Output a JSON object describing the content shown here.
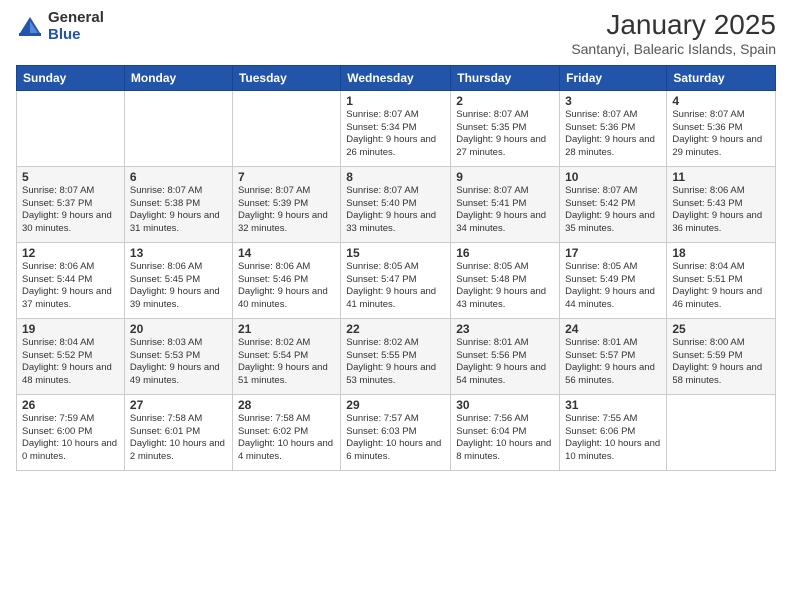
{
  "logo": {
    "general": "General",
    "blue": "Blue"
  },
  "title": "January 2025",
  "subtitle": "Santanyi, Balearic Islands, Spain",
  "headers": [
    "Sunday",
    "Monday",
    "Tuesday",
    "Wednesday",
    "Thursday",
    "Friday",
    "Saturday"
  ],
  "weeks": [
    [
      {
        "day": "",
        "info": ""
      },
      {
        "day": "",
        "info": ""
      },
      {
        "day": "",
        "info": ""
      },
      {
        "day": "1",
        "info": "Sunrise: 8:07 AM\nSunset: 5:34 PM\nDaylight: 9 hours and 26 minutes."
      },
      {
        "day": "2",
        "info": "Sunrise: 8:07 AM\nSunset: 5:35 PM\nDaylight: 9 hours and 27 minutes."
      },
      {
        "day": "3",
        "info": "Sunrise: 8:07 AM\nSunset: 5:36 PM\nDaylight: 9 hours and 28 minutes."
      },
      {
        "day": "4",
        "info": "Sunrise: 8:07 AM\nSunset: 5:36 PM\nDaylight: 9 hours and 29 minutes."
      }
    ],
    [
      {
        "day": "5",
        "info": "Sunrise: 8:07 AM\nSunset: 5:37 PM\nDaylight: 9 hours and 30 minutes."
      },
      {
        "day": "6",
        "info": "Sunrise: 8:07 AM\nSunset: 5:38 PM\nDaylight: 9 hours and 31 minutes."
      },
      {
        "day": "7",
        "info": "Sunrise: 8:07 AM\nSunset: 5:39 PM\nDaylight: 9 hours and 32 minutes."
      },
      {
        "day": "8",
        "info": "Sunrise: 8:07 AM\nSunset: 5:40 PM\nDaylight: 9 hours and 33 minutes."
      },
      {
        "day": "9",
        "info": "Sunrise: 8:07 AM\nSunset: 5:41 PM\nDaylight: 9 hours and 34 minutes."
      },
      {
        "day": "10",
        "info": "Sunrise: 8:07 AM\nSunset: 5:42 PM\nDaylight: 9 hours and 35 minutes."
      },
      {
        "day": "11",
        "info": "Sunrise: 8:06 AM\nSunset: 5:43 PM\nDaylight: 9 hours and 36 minutes."
      }
    ],
    [
      {
        "day": "12",
        "info": "Sunrise: 8:06 AM\nSunset: 5:44 PM\nDaylight: 9 hours and 37 minutes."
      },
      {
        "day": "13",
        "info": "Sunrise: 8:06 AM\nSunset: 5:45 PM\nDaylight: 9 hours and 39 minutes."
      },
      {
        "day": "14",
        "info": "Sunrise: 8:06 AM\nSunset: 5:46 PM\nDaylight: 9 hours and 40 minutes."
      },
      {
        "day": "15",
        "info": "Sunrise: 8:05 AM\nSunset: 5:47 PM\nDaylight: 9 hours and 41 minutes."
      },
      {
        "day": "16",
        "info": "Sunrise: 8:05 AM\nSunset: 5:48 PM\nDaylight: 9 hours and 43 minutes."
      },
      {
        "day": "17",
        "info": "Sunrise: 8:05 AM\nSunset: 5:49 PM\nDaylight: 9 hours and 44 minutes."
      },
      {
        "day": "18",
        "info": "Sunrise: 8:04 AM\nSunset: 5:51 PM\nDaylight: 9 hours and 46 minutes."
      }
    ],
    [
      {
        "day": "19",
        "info": "Sunrise: 8:04 AM\nSunset: 5:52 PM\nDaylight: 9 hours and 48 minutes."
      },
      {
        "day": "20",
        "info": "Sunrise: 8:03 AM\nSunset: 5:53 PM\nDaylight: 9 hours and 49 minutes."
      },
      {
        "day": "21",
        "info": "Sunrise: 8:02 AM\nSunset: 5:54 PM\nDaylight: 9 hours and 51 minutes."
      },
      {
        "day": "22",
        "info": "Sunrise: 8:02 AM\nSunset: 5:55 PM\nDaylight: 9 hours and 53 minutes."
      },
      {
        "day": "23",
        "info": "Sunrise: 8:01 AM\nSunset: 5:56 PM\nDaylight: 9 hours and 54 minutes."
      },
      {
        "day": "24",
        "info": "Sunrise: 8:01 AM\nSunset: 5:57 PM\nDaylight: 9 hours and 56 minutes."
      },
      {
        "day": "25",
        "info": "Sunrise: 8:00 AM\nSunset: 5:59 PM\nDaylight: 9 hours and 58 minutes."
      }
    ],
    [
      {
        "day": "26",
        "info": "Sunrise: 7:59 AM\nSunset: 6:00 PM\nDaylight: 10 hours and 0 minutes."
      },
      {
        "day": "27",
        "info": "Sunrise: 7:58 AM\nSunset: 6:01 PM\nDaylight: 10 hours and 2 minutes."
      },
      {
        "day": "28",
        "info": "Sunrise: 7:58 AM\nSunset: 6:02 PM\nDaylight: 10 hours and 4 minutes."
      },
      {
        "day": "29",
        "info": "Sunrise: 7:57 AM\nSunset: 6:03 PM\nDaylight: 10 hours and 6 minutes."
      },
      {
        "day": "30",
        "info": "Sunrise: 7:56 AM\nSunset: 6:04 PM\nDaylight: 10 hours and 8 minutes."
      },
      {
        "day": "31",
        "info": "Sunrise: 7:55 AM\nSunset: 6:06 PM\nDaylight: 10 hours and 10 minutes."
      },
      {
        "day": "",
        "info": ""
      }
    ]
  ]
}
